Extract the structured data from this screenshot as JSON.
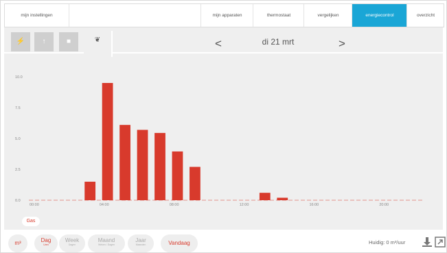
{
  "nav": {
    "settings_label": "mijn instellingen",
    "tabs": [
      {
        "label": "mijn apparaten",
        "active": false
      },
      {
        "label": "thermostaat",
        "active": false
      },
      {
        "label": "vergelijken",
        "active": false
      },
      {
        "label": "energiecontrol",
        "active": true
      },
      {
        "label": "overzicht",
        "active": false
      }
    ]
  },
  "energy_tabs": [
    {
      "icon": "lightning-icon",
      "selected": false
    },
    {
      "icon": "thermometer-icon",
      "selected": false
    },
    {
      "icon": "tap-icon",
      "selected": false
    },
    {
      "icon": "flame-icon",
      "selected": true
    }
  ],
  "date_nav": {
    "prev": "<",
    "date": "di 21 mrt",
    "next": ">"
  },
  "colors": {
    "accent": "#1aa6d6",
    "gas": "#d83a2c",
    "bar": "#d83a2c"
  },
  "chart_data": {
    "type": "bar",
    "x_unit": "hour",
    "y_ticks": [
      "0.0",
      "2.5",
      "5.0",
      "7.5",
      "10.0"
    ],
    "x_ticks": [
      "00:00",
      "04:00",
      "08:00",
      "12:00",
      "16:00",
      "20:00"
    ],
    "ylim": [
      0,
      10
    ],
    "xlim": [
      0,
      22.5
    ],
    "x": [
      0,
      1,
      2,
      3,
      4,
      5,
      6,
      7,
      8,
      9,
      10,
      11,
      12,
      13,
      14,
      15,
      16,
      17,
      18,
      19,
      20,
      21,
      22
    ],
    "values": [
      0,
      0,
      0,
      1.5,
      9.5,
      6.1,
      5.7,
      5.45,
      3.95,
      2.7,
      0,
      0,
      0,
      0.6,
      0.2,
      0,
      0,
      0,
      0,
      0,
      0,
      0,
      0
    ],
    "series_name": "Gas",
    "grid": false,
    "legend": "bottom-left"
  },
  "legend_label": "Gas",
  "bottom": {
    "unit": "m³",
    "periods": [
      {
        "label": "Dag",
        "sub": "Uren",
        "active": true
      },
      {
        "label": "Week",
        "sub": "Dagen",
        "active": false
      },
      {
        "label": "Maand",
        "sub": "Weken / Dagen",
        "active": false
      },
      {
        "label": "Jaar",
        "sub": "Maanden",
        "active": false
      }
    ],
    "today": "Vandaag",
    "status": "Huidig: 0 m³/uur"
  }
}
